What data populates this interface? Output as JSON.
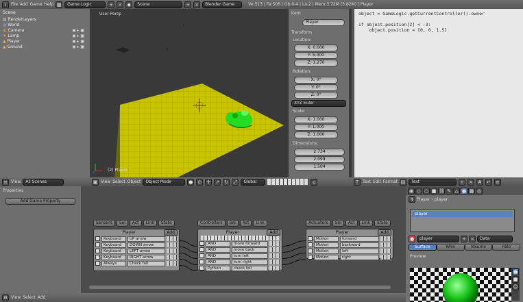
{
  "top": {
    "menus": [
      "File",
      "Add",
      "Game",
      "Help"
    ],
    "layout": "Game Logic",
    "scene": "Scene",
    "engine": "Blender Game",
    "stats": "Ve:513 | Fa:506 | Ob:0-4 | La:2 | Mem:3.72M (3.82M) | Player"
  },
  "outliner": {
    "root": "Scene",
    "items": [
      "RenderLayers",
      "World",
      "Camera",
      "Lamp",
      "Player",
      "Ground"
    ]
  },
  "viewport": {
    "label": "User Persp",
    "selected": "(2) Player",
    "menus": [
      "View",
      "Select",
      "Object"
    ],
    "mode": "Object Mode",
    "orientation": "Global"
  },
  "outliner_footer": {
    "view": "View",
    "filter": "All Scenes"
  },
  "props": {
    "item_header": "Item",
    "name": "Player",
    "transform_header": "Transform",
    "location_label": "Location:",
    "location": [
      "X: 0.000",
      "Y: 5.000",
      "Z: 1.270"
    ],
    "rotation_label": "Rotation:",
    "rotation": [
      "X: 0°",
      "Y: 0°",
      "Z: 0°"
    ],
    "rotation_mode": "XYZ Euler",
    "scale_label": "Scale:",
    "scale": [
      "X: 1.000",
      "Y: 1.000",
      "Z: 1.000"
    ],
    "dimensions_label": "Dimensions:",
    "dimensions": [
      "2.734",
      "2.099",
      "1.504"
    ]
  },
  "text": {
    "lines": [
      "object = GameLogic.getCurrentController().owner",
      "",
      "if object.position[2] < -3:",
      "    object.position = [0, 0, 1.5]"
    ],
    "menus": [
      "Text",
      "Edit",
      "Format"
    ],
    "name": "Text"
  },
  "logic": {
    "properties_header": "Properties",
    "add_prop": "Add Game Property",
    "sensors_btn": "Sensors",
    "controllers_btn": "Controllers",
    "actuators_btn": "Actuators",
    "filter_tabs": [
      "Sel",
      "Act",
      "Link",
      "State"
    ],
    "obj": "Player",
    "add": "Add",
    "sensors": [
      {
        "type": "Keyboard",
        "name": "UP arrow"
      },
      {
        "type": "Keyboard",
        "name": "DOWN arrow"
      },
      {
        "type": "Keyboard",
        "name": "LEFT arrow"
      },
      {
        "type": "Keyboard",
        "name": "RIGHT arrow"
      },
      {
        "type": "Always",
        "name": "Check fall"
      }
    ],
    "controllers": [
      {
        "type": "AND",
        "name": "move forward"
      },
      {
        "type": "AND",
        "name": "move back"
      },
      {
        "type": "AND",
        "name": "turn left"
      },
      {
        "type": "AND",
        "name": "turn right"
      },
      {
        "type": "Python",
        "name": "check fall"
      }
    ],
    "actuators": [
      {
        "type": "Motion",
        "name": "forward"
      },
      {
        "type": "Motion",
        "name": "backward"
      },
      {
        "type": "Motion",
        "name": "left"
      },
      {
        "type": "Motion",
        "name": "right"
      }
    ],
    "footer_menus": [
      "View",
      "Select",
      "Add"
    ]
  },
  "material": {
    "crumb_obj": "Player",
    "crumb_mat": "player",
    "slot": "player",
    "name": "player",
    "data": "Data",
    "tabs": [
      "Surface",
      "Wire",
      "Volume",
      "Halo"
    ],
    "preview_header": "Preview"
  },
  "colors": {
    "floor": "#c8c400",
    "player": "#22dd22",
    "selection": "#5680c2"
  }
}
